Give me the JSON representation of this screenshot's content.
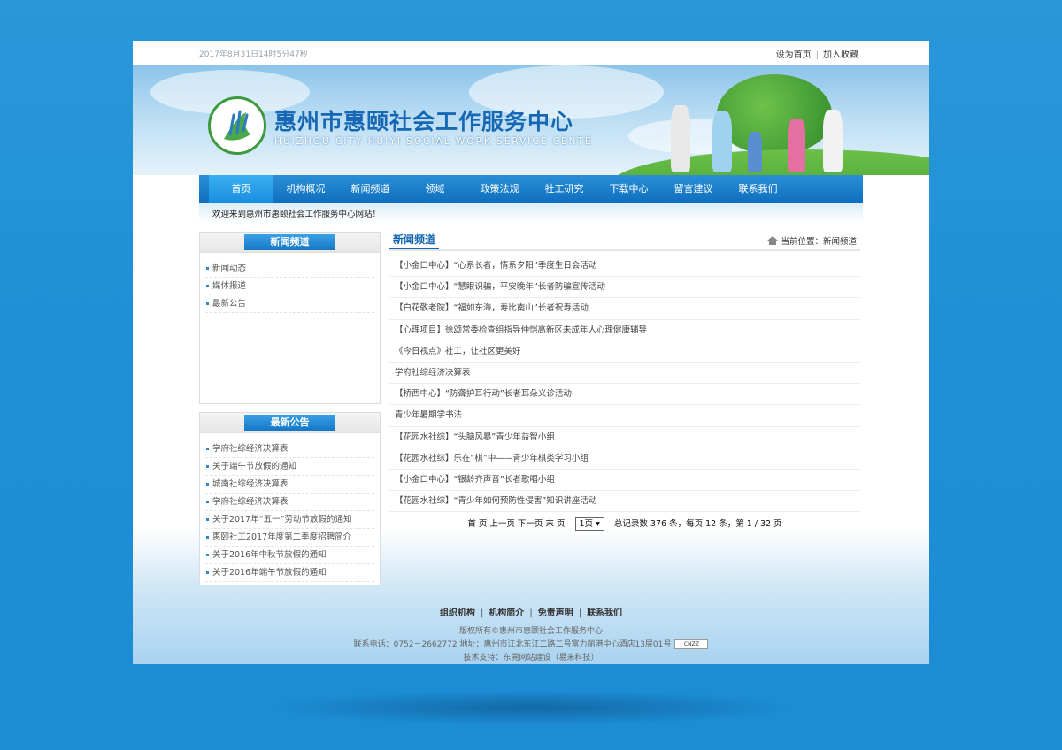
{
  "topbar": {
    "date": "2017年8月31日14时5分47秒",
    "set_home": "设为首页",
    "add_fav": "加入收藏"
  },
  "banner": {
    "title_cn": "惠州市惠颐社会工作服务中心",
    "title_en": "HUIZHOU CITY HUIYI SOCIAL WORK SERVICE CENTE"
  },
  "nav": {
    "items": [
      "首页",
      "机构概况",
      "新闻频道",
      "领域",
      "政策法规",
      "社工研究",
      "下载中心",
      "留言建议",
      "联系我们"
    ]
  },
  "welcome": "欢迎来到惠州市惠颐社会工作服务中心网站！",
  "sidebar": {
    "news_title": "新闻频道",
    "news_items": [
      "新闻动态",
      "媒体报道",
      "最新公告"
    ],
    "notice_title": "最新公告",
    "notice_items": [
      "学府社综经济决算表",
      "关于端午节放假的通知",
      "城南社综经济决算表",
      "学府社综经济决算表",
      "关于2017年“五一”劳动节放假的通知",
      "惠颐社工2017年度第二季度招聘简介",
      "关于2016年中秋节放假的通知",
      "关于2016年端午节放假的通知"
    ]
  },
  "main": {
    "title": "新闻频道",
    "crumb": "当前位置：新闻频道",
    "news": [
      "【小金口中心】“心系长者，情系夕阳”季度生日会活动",
      "【小金口中心】“慧眼识骗，平安晚年”长者防骗宣传活动",
      "【白花敬老院】“福如东海，寿比南山”长者祝寿活动",
      "【心理项目】徐颂常委检查组指导仲恺高新区未成年人心理健康辅导",
      "《今日视点》社工，让社区更美好",
      "学府社综经济决算表",
      "【桥西中心】“防聋护耳行动”长者耳朵义诊活动",
      "青少年暑期学书法",
      "【花园水社综】“头脑风暴”青少年益智小组",
      "【花园水社综】乐在“棋”中——青少年棋类学习小组",
      "【小金口中心】“银龄齐声音”长者歌唱小组",
      "【花园水社综】“青少年如何预防性侵害”知识讲座活动"
    ]
  },
  "pager": {
    "links": "首 页  上一页  下一页  末 页",
    "select": "1页",
    "summary": "总记录数 376 条，每页 12 条，第 1 / 32 页"
  },
  "footer": {
    "links": [
      "组织机构",
      "机构简介",
      "免责声明",
      "联系我们"
    ],
    "copyright": "版权所有©惠州市惠颐社会工作服务中心",
    "contact": "联系电话：0752－2662772  地址：惠州市江北东江二路二号富力丽港中心酒店13层01号",
    "cnzz": "CNZZ",
    "support": "技术支持：东莞网站建设（易米科技）"
  }
}
